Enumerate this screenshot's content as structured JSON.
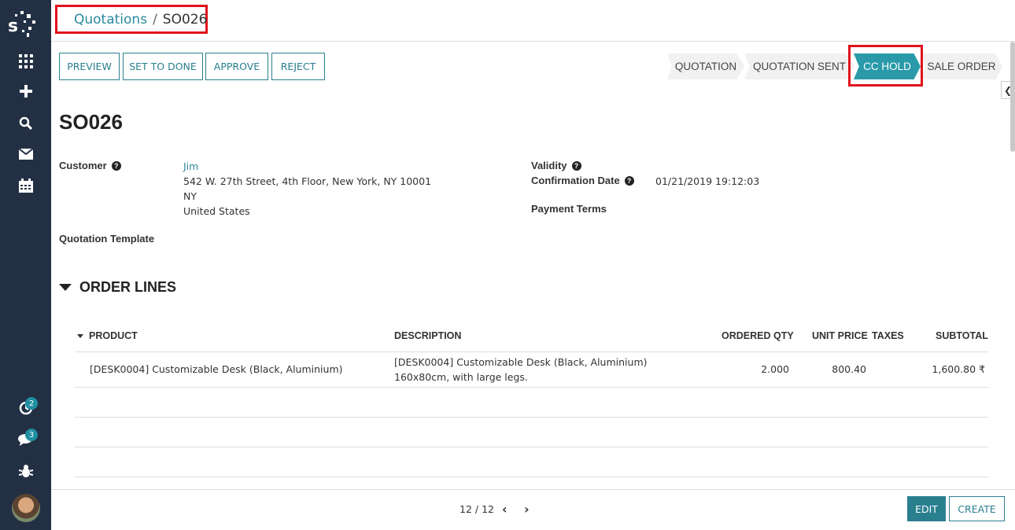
{
  "breadcrumb": {
    "parent": "Quotations",
    "separator": "/",
    "current": "SO026"
  },
  "sidebar": {
    "logo": "s",
    "icons": [
      "apps-grid-icon",
      "plus-icon",
      "search-icon",
      "envelope-icon",
      "calendar-icon",
      "activity-icon",
      "chat-icon",
      "bug-icon"
    ],
    "activity_count": "2",
    "messages_count": "3"
  },
  "actions": {
    "preview": "PREVIEW",
    "set_to_done": "SET TO DONE",
    "approve": "APPROVE",
    "reject": "REJECT"
  },
  "statusbar": {
    "stages": [
      "QUOTATION",
      "QUOTATION SENT",
      "CC HOLD",
      "SALE ORDER"
    ],
    "active": "CC HOLD"
  },
  "record": {
    "title": "SO026",
    "customer_label": "Customer",
    "customer_name": "Jim",
    "address_line1": "542 W. 27th Street, 4th Floor, New York, NY 10001",
    "address_line2": "NY",
    "address_line3": "United States",
    "quotation_template_label": "Quotation Template",
    "validity_label": "Validity",
    "confirmation_date_label": "Confirmation Date",
    "confirmation_date": "01/21/2019 19:12:03",
    "payment_terms_label": "Payment Terms",
    "help_glyph": "?"
  },
  "order_lines": {
    "section_title": "ORDER LINES",
    "columns": {
      "product": "PRODUCT",
      "description": "DESCRIPTION",
      "ordered_qty": "ORDERED QTY",
      "unit_price": "UNIT PRICE",
      "taxes": "TAXES",
      "subtotal": "SUBTOTAL"
    },
    "rows": [
      {
        "product": "[DESK0004] Customizable Desk (Black, Aluminium)",
        "description_line1": "[DESK0004] Customizable Desk (Black, Aluminium)",
        "description_line2": "160x80cm, with large legs.",
        "ordered_qty": "2.000",
        "unit_price": "800.40",
        "taxes": "",
        "subtotal": "1,600.80 ₹"
      }
    ]
  },
  "pager": {
    "text": "12 / 12"
  },
  "footer": {
    "edit": "EDIT",
    "create": "CREATE"
  },
  "colors": {
    "sidebar": "#233044",
    "accent": "#2a7f8f",
    "highlight": "#e0121c",
    "active_stage": "#2a9aaa"
  }
}
